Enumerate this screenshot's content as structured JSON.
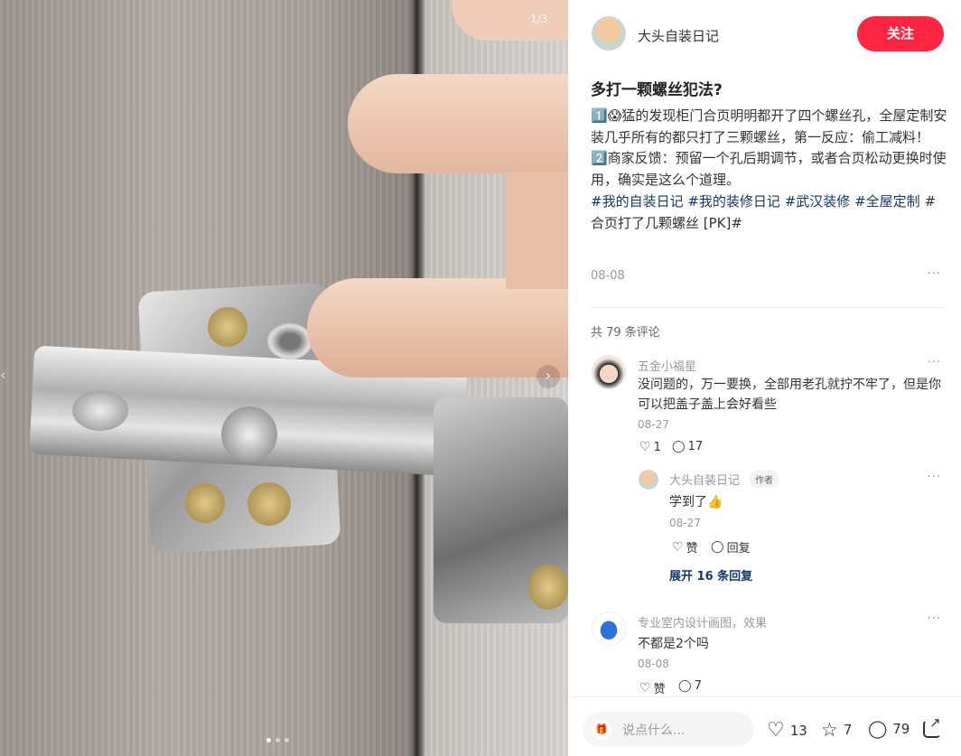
{
  "image_viewer": {
    "counter": "1/3",
    "dots": 3,
    "active_dot": 0
  },
  "author": {
    "name": "大头自装日记",
    "follow_label": "关注"
  },
  "post": {
    "title": "多打一颗螺丝犯法?",
    "lines": [
      "1️⃣😱猛的发现柜门合页明明都开了四个螺丝孔，全屋定制安装几乎所有的都只打了三颗螺丝，第一反应：偷工减料！",
      "2️⃣商家反馈：预留一个孔后期调节，或者合页松动更换时使用，确实是这么个道理。"
    ],
    "tags": [
      "#我的自装日记",
      "#我的装修日记",
      "#武汉装修",
      "#全屋定制",
      "#合页打了几颗螺丝 [PK]#"
    ],
    "date": "08-08"
  },
  "comments_header": "共 79 条评论",
  "comments": [
    {
      "name": "五金小福星",
      "text": "没问题的，万一要换，全部用老孔就拧不牢了，但是你可以把盖子盖上会好看些",
      "date": "08-27",
      "likes": "1",
      "replies": "17",
      "reply": {
        "name": "大头自装日记",
        "badge": "作者",
        "text": "学到了👍",
        "date": "08-27",
        "like_label": "赞",
        "reply_label": "回复"
      },
      "expand_label": "展开 16 条回复"
    },
    {
      "name": "专业室内设计画图，效果",
      "text": "不都是2个吗",
      "date": "08-08",
      "likes": "赞",
      "replies": "7"
    }
  ],
  "bottom_bar": {
    "placeholder": "说点什么...",
    "likes": "13",
    "stars": "7",
    "comments": "79"
  },
  "colors": {
    "accent": "#ff2442",
    "tag": "#13386c"
  }
}
